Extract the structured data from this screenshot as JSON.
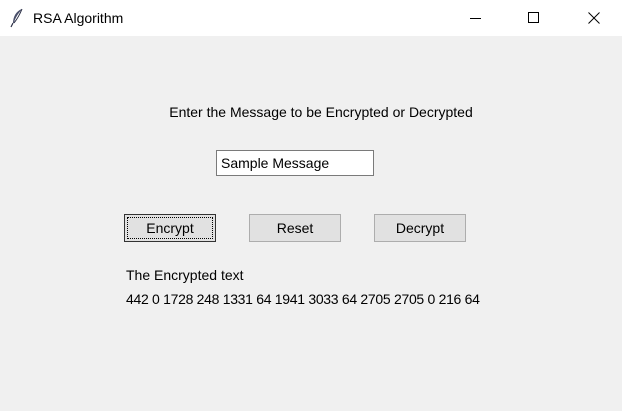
{
  "window": {
    "title": "RSA Algorithm",
    "icon": "feather-icon"
  },
  "form": {
    "prompt": "Enter the Message to be Encrypted or Decrypted",
    "message_value": "Sample Message"
  },
  "buttons": {
    "encrypt": "Encrypt",
    "reset": "Reset",
    "decrypt": "Decrypt"
  },
  "result": {
    "label": "The Encrypted text",
    "value": "442 0 1728 248 1331 64 1941 3033 64 2705 2705 0 216 64"
  },
  "colors": {
    "background": "#f0f0f0",
    "button_face": "#e1e1e1"
  }
}
